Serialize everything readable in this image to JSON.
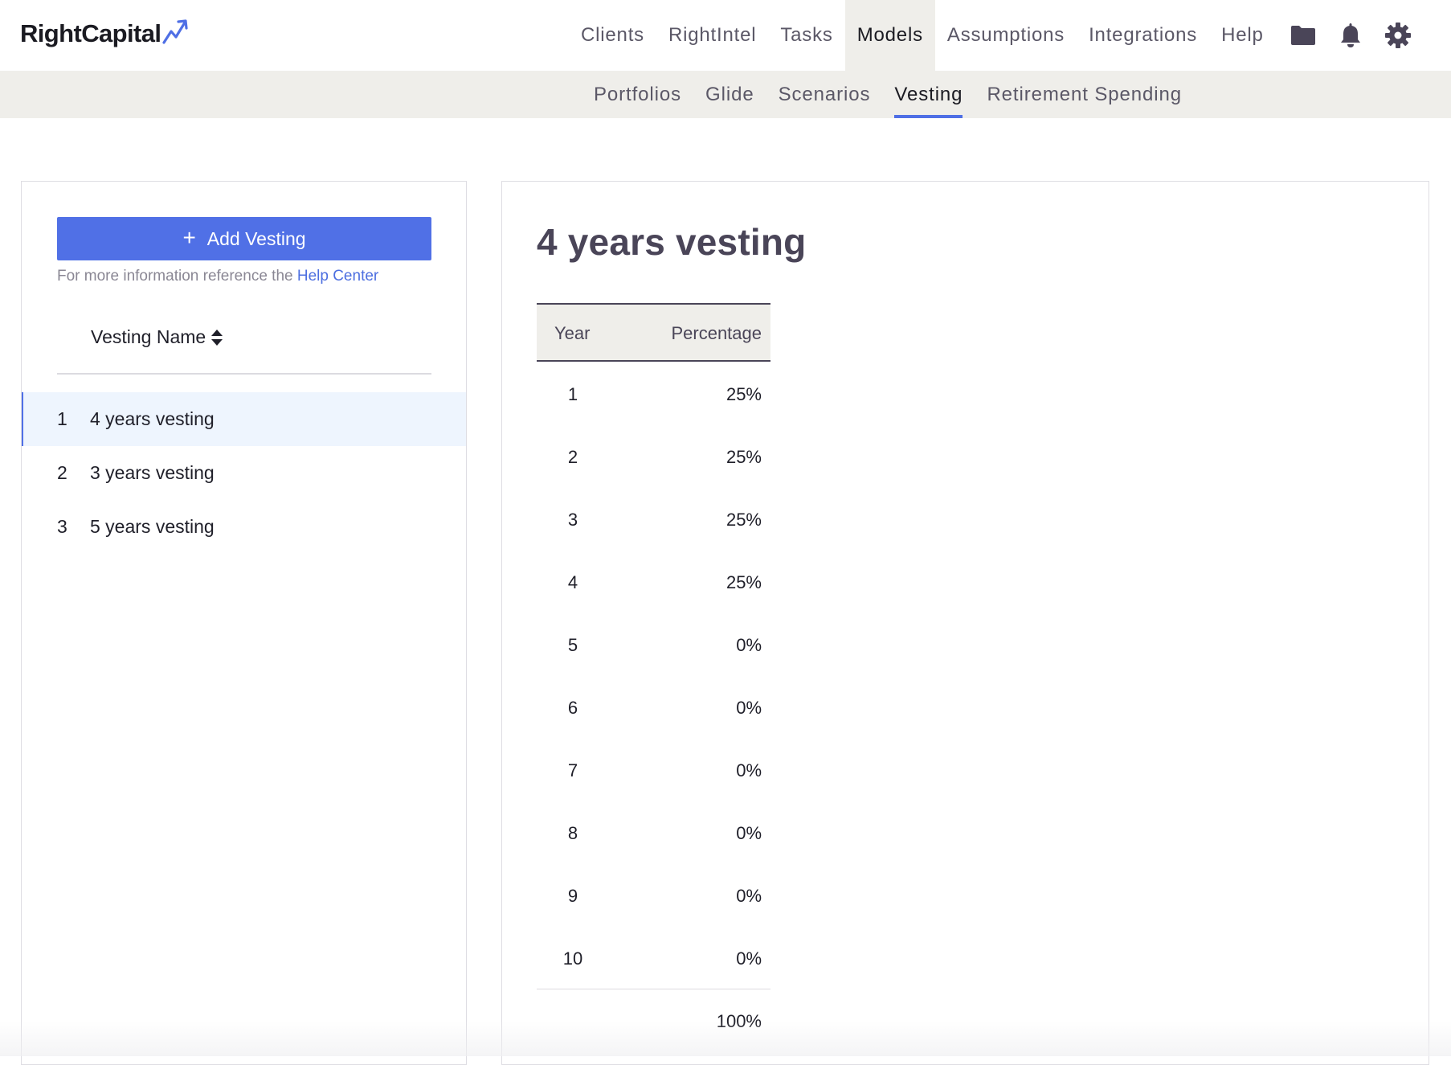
{
  "brand": {
    "name": "RightCapital",
    "accent": "#4f6fe5"
  },
  "main_nav": [
    {
      "label": "Clients",
      "active": false
    },
    {
      "label": "RightIntel",
      "active": false
    },
    {
      "label": "Tasks",
      "active": false
    },
    {
      "label": "Models",
      "active": true
    },
    {
      "label": "Assumptions",
      "active": false
    },
    {
      "label": "Integrations",
      "active": false
    },
    {
      "label": "Help",
      "active": false
    }
  ],
  "nav_icons": [
    "folder-icon",
    "bell-icon",
    "gear-icon"
  ],
  "sub_nav": [
    {
      "label": "Portfolios",
      "active": false
    },
    {
      "label": "Glide",
      "active": false
    },
    {
      "label": "Scenarios",
      "active": false
    },
    {
      "label": "Vesting",
      "active": true
    },
    {
      "label": "Retirement Spending",
      "active": false
    }
  ],
  "left_panel": {
    "add_button_label": "Add Vesting",
    "help_text": "For more information reference the",
    "help_link": "Help Center",
    "column_header": "Vesting Name",
    "items": [
      {
        "index": "1",
        "name": "4 years vesting",
        "selected": true
      },
      {
        "index": "2",
        "name": "3 years vesting",
        "selected": false
      },
      {
        "index": "3",
        "name": "5 years vesting",
        "selected": false
      }
    ]
  },
  "detail": {
    "title": "4 years vesting",
    "columns": {
      "year": "Year",
      "percentage": "Percentage"
    },
    "rows": [
      {
        "year": "1",
        "percentage": "25%"
      },
      {
        "year": "2",
        "percentage": "25%"
      },
      {
        "year": "3",
        "percentage": "25%"
      },
      {
        "year": "4",
        "percentage": "25%"
      },
      {
        "year": "5",
        "percentage": "0%"
      },
      {
        "year": "6",
        "percentage": "0%"
      },
      {
        "year": "7",
        "percentage": "0%"
      },
      {
        "year": "8",
        "percentage": "0%"
      },
      {
        "year": "9",
        "percentage": "0%"
      },
      {
        "year": "10",
        "percentage": "0%"
      }
    ],
    "total": "100%"
  }
}
